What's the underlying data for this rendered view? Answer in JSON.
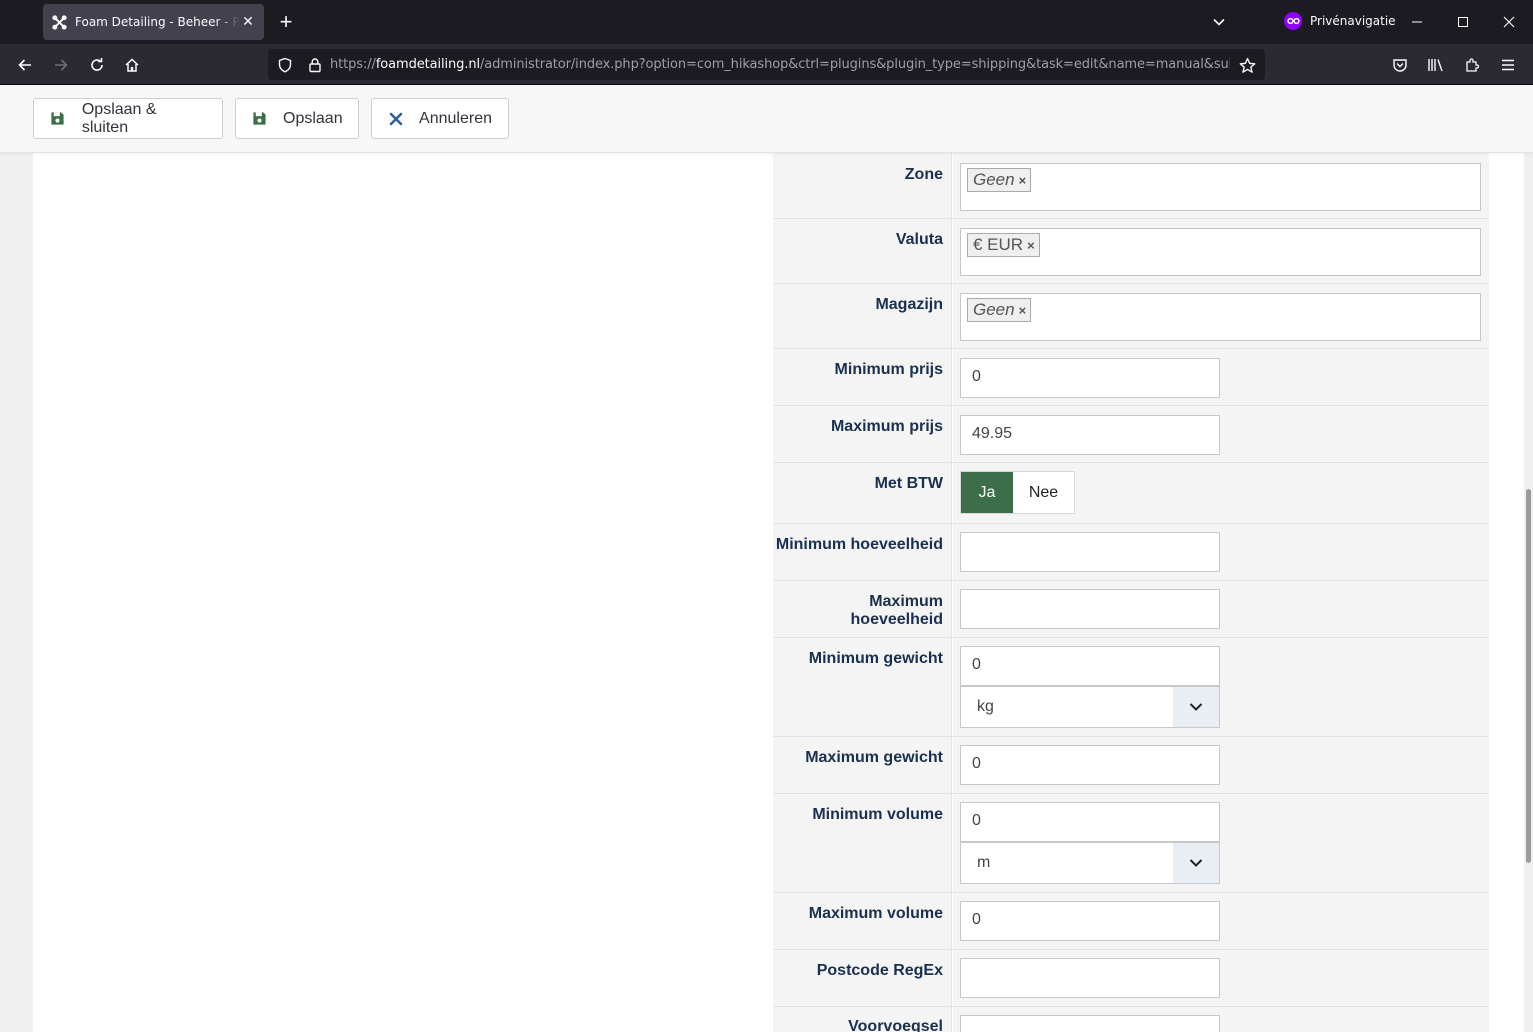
{
  "browser": {
    "tab_title": "Foam Detailing - Beheer - Plugins",
    "private_label": "Privénavigatie",
    "url_prefix": "https://",
    "url_host": "foamdetailing.nl",
    "url_path": "/administrator/index.php?option=com_hikashop&ctrl=plugins&plugin_type=shipping&task=edit&name=manual&subtask=shipping_edit"
  },
  "toolbar": {
    "save_close_label": "Opslaan & sluiten",
    "save_label": "Opslaan",
    "cancel_label": "Annuleren"
  },
  "form": {
    "zone": {
      "label": "Zone",
      "chip": "Geen"
    },
    "valuta": {
      "label": "Valuta",
      "chip": "€ EUR"
    },
    "magazijn": {
      "label": "Magazijn",
      "chip": "Geen"
    },
    "min_prijs": {
      "label": "Minimum prijs",
      "value": "0"
    },
    "max_prijs": {
      "label": "Maximum prijs",
      "value": "49.95"
    },
    "met_btw": {
      "label": "Met BTW",
      "yes": "Ja",
      "no": "Nee",
      "selected": "Ja"
    },
    "min_hoeveelheid": {
      "label": "Minimum hoeveelheid",
      "value": ""
    },
    "max_hoeveelheid": {
      "label": "Maximum hoeveelheid",
      "value": ""
    },
    "min_gewicht": {
      "label": "Minimum gewicht",
      "value": "0",
      "unit": "kg"
    },
    "max_gewicht": {
      "label": "Maximum gewicht",
      "value": "0"
    },
    "min_volume": {
      "label": "Minimum volume",
      "value": "0",
      "unit": "m"
    },
    "max_volume": {
      "label": "Maximum volume",
      "value": "0"
    },
    "postcode_regex": {
      "label": "Postcode RegEx",
      "value": ""
    },
    "voorvoegsel": {
      "label": "Voorvoegsel"
    }
  },
  "colors": {
    "toggle_active": "#3c6e4a",
    "label_text": "#1a3050",
    "browser_dark": "#1c1b22",
    "private_purple": "#8f00ff"
  }
}
